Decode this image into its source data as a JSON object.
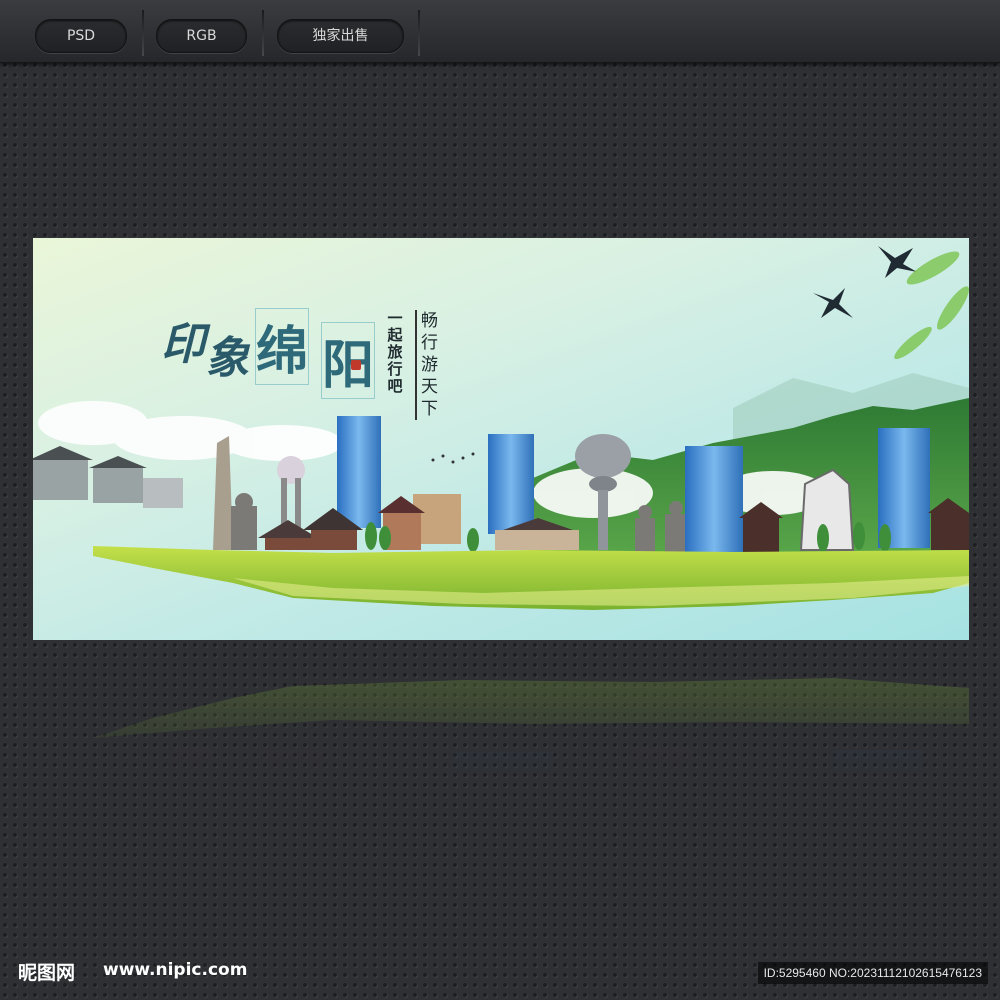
{
  "toolbar": {
    "tags": [
      {
        "label": "PSD"
      },
      {
        "label": "RGB"
      },
      {
        "label": "独家出售"
      }
    ]
  },
  "banner": {
    "title_chars": [
      "印",
      "象",
      "绵",
      "阳"
    ],
    "subtitle_lines": [
      "一",
      "起",
      "旅",
      "行",
      "吧"
    ],
    "slogan_chars": [
      "畅",
      "行",
      "游",
      "天",
      "下"
    ]
  },
  "footer": {
    "logo": "昵图网",
    "site": "www.nipic.com",
    "id_text": "ID:5295460 NO:20231112102615476123"
  },
  "colors": {
    "page_bg": "#2e3034",
    "toolbar_bg": "#323438",
    "sky_light": "#eaf6d8",
    "sky_teal": "#a6e2e2",
    "grass": "#a8d23c",
    "mountain": "#3f8a3a",
    "building_blue": "#4a90d9",
    "title_ink": "#2a5a6a"
  }
}
